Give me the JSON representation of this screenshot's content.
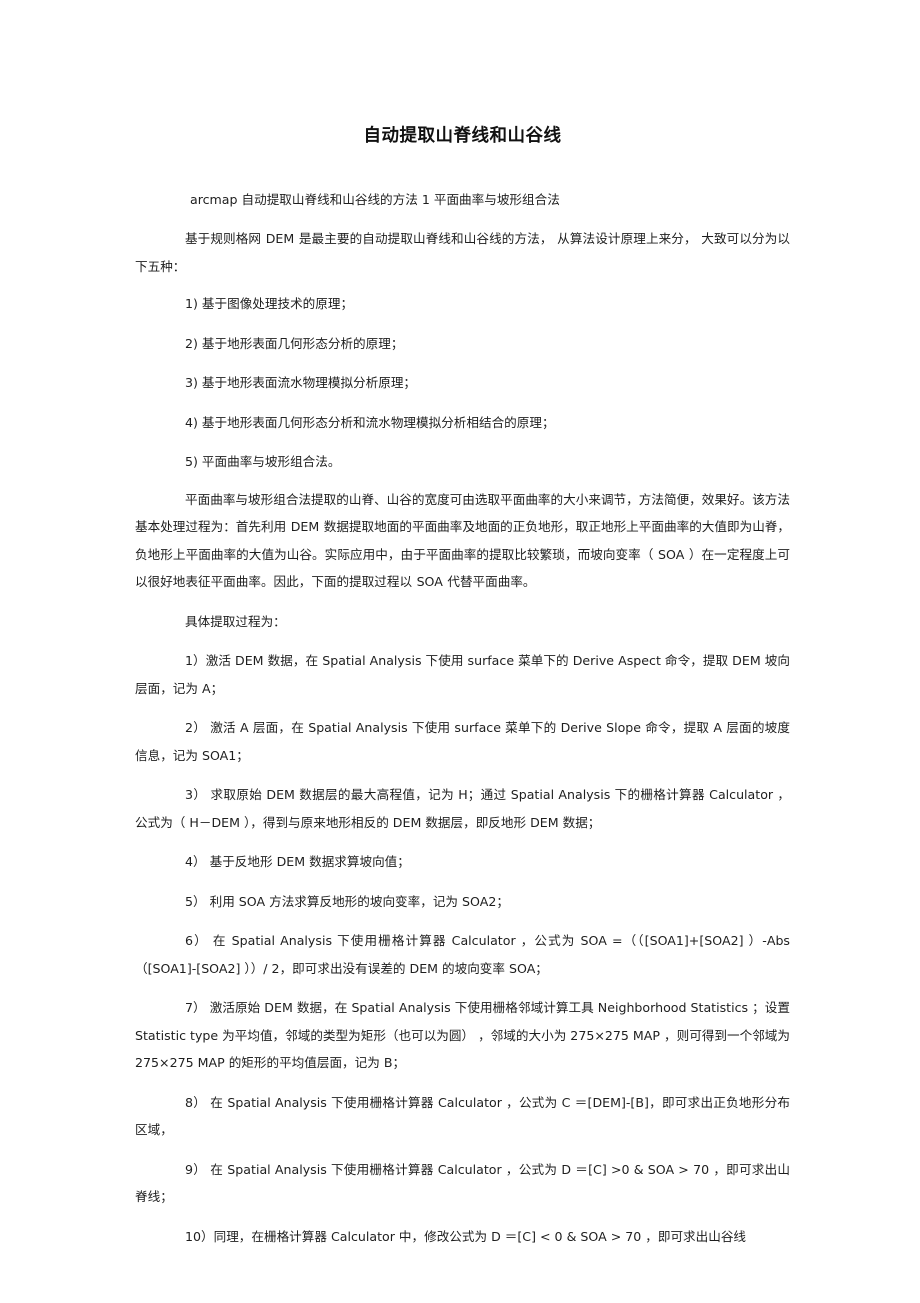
{
  "document": {
    "title": "自动提取山脊线和山谷线",
    "subtitle": "arcmap  自动提取山脊线和山谷线的方法     1  平面曲率与坡形组合法",
    "intro_paragraph": "基于规则格网  DEM  是最主要的自动提取山脊线和山谷线的方法，     从算法设计原理上来分，    大致可以分为以下五种：",
    "principles": [
      "1)  基于图像处理技术的原理；",
      "2)  基于地形表面几何形态分析的原理；",
      "3)  基于地形表面流水物理模拟分析原理；",
      "4)  基于地形表面几何形态分析和流水物理模拟分析相结合的原理；",
      "5)  平面曲率与坡形组合法。"
    ],
    "method_paragraph": "平面曲率与坡形组合法提取的山脊、山谷的宽度可由选取平面曲率的大小来调节，方法简便，效果好。该方法基本处理过程为：首先利用      DEM  数据提取地面的平面曲率及地面的正负地形，取正地形上平面曲率的大值即为山脊，负地形上平面曲率的大值为山谷。实际应用中，由于平面曲率的提取比较繁琐，而坡向变率（  SOA  ）在一定程度上可以很好地表征平面曲率。因此，下面的提取过程以        SOA  代替平面曲率。",
    "steps_heading": "具体提取过程为：",
    "steps": [
      "1）激活  DEM  数据，在  Spatial Analysis    下使用  surface   菜单下的  Derive Aspect    命令，提取  DEM  坡向层面，记为    A；",
      "2）  激活  A  层面，在  Spatial Analysis    下使用  surface   菜单下的  Derive Slope    命令，提取  A  层面的坡度信息，记为    SOA1；",
      "3）  求取原始  DEM  数据层的最大高程值，记为    H；通过  Spatial Analysis    下的栅格计算器  Calculator  ，公式为（  H－DEM  ），得到与原来地形相反的    DEM  数据层，即反地形  DEM  数据；",
      "4）  基于反地形  DEM  数据求算坡向值；",
      "5）  利用  SOA  方法求算反地形的坡向变率，记为    SOA2；",
      "6）  在 Spatial Analysis    下使用栅格计算器    Calculator ，公式为 SOA  =（（[SOA1]+[SOA2]  ）-Abs（[SOA1]-[SOA2]  ））/ 2，即可求出没有误差的    DEM  的坡向变率  SOA；",
      "7）  激活原始  DEM  数据，在  Spatial Analysis    下使用栅格邻域计算工具     Neighborhood Statistics  ；设置  Statistic type    为平均值，邻域的类型为矩形（也可以为圆）      ，邻域的大小为    275×275 MAP ，则可得到一个邻域为    275×275 MAP  的矩形的平均值层面，记为    B；",
      "8）  在  Spatial Analysis    下使用栅格计算器    Calculator ，公式为  C  ＝[DEM]-[B]，即可求出正负地形分布区域，",
      "9）  在  Spatial Analysis    下使用栅格计算器    Calculator ，公式为  D  ＝[C] >0 & SOA > 70 ，即可求出山脊线；",
      "10）同理，在栅格计算器    Calculator   中，修改公式为    D  ＝[C] < 0 & SOA > 70  ，即可求出山谷线"
    ]
  }
}
